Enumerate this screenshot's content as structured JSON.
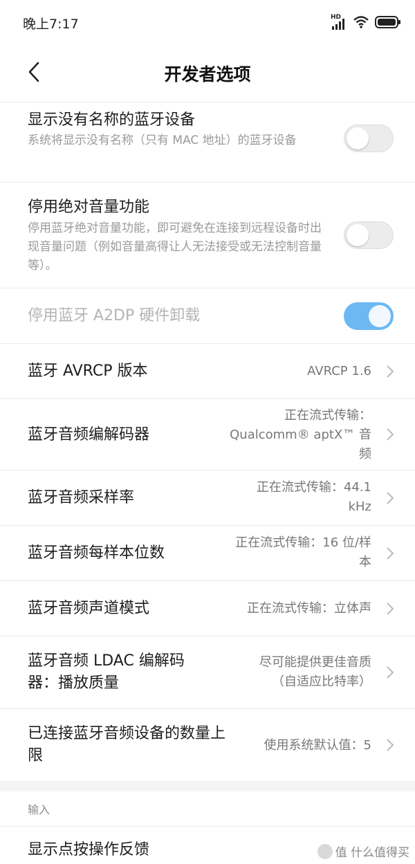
{
  "status": {
    "time": "晚上7:17",
    "network": "HD"
  },
  "header": {
    "title": "开发者选项"
  },
  "rows": [
    {
      "title": "显示没有名称的蓝牙设备",
      "subtitle": "系统将显示没有名称（只有 MAC 地址）的蓝牙设备",
      "toggle_on": false
    },
    {
      "title": "停用绝对音量功能",
      "subtitle": "停用蓝牙绝对音量功能，即可避免在连接到远程设备时出现音量问题（例如音量高得让人无法接受或无法控制音量等）。",
      "toggle_on": false
    },
    {
      "title": "停用蓝牙 A2DP 硬件卸载",
      "toggle_on": true,
      "disabled": true
    },
    {
      "title": "蓝牙 AVRCP 版本",
      "value": "AVRCP 1.6"
    },
    {
      "title": "蓝牙音频编解码器",
      "value": "正在流式传输：Qualcomm® aptX™ 音频"
    },
    {
      "title": "蓝牙音频采样率",
      "value": "正在流式传输：44.1 kHz"
    },
    {
      "title": "蓝牙音频每样本位数",
      "value": "正在流式传输：16 位/样本"
    },
    {
      "title": "蓝牙音频声道模式",
      "value": "正在流式传输：立体声"
    },
    {
      "title": "蓝牙音频 LDAC 编解码器：播放质量",
      "value": "尽可能提供更佳音质（自适应比特率）"
    },
    {
      "title": "已连接蓝牙音频设备的数量上限",
      "value": "使用系统默认值：5"
    },
    {
      "title": "显示点按操作反馈"
    }
  ],
  "section": {
    "label": "输入"
  },
  "watermark": {
    "text": "值 什么值得买"
  },
  "colors": {
    "toggle_on": "#6cb8f2",
    "divider": "#ececec"
  }
}
